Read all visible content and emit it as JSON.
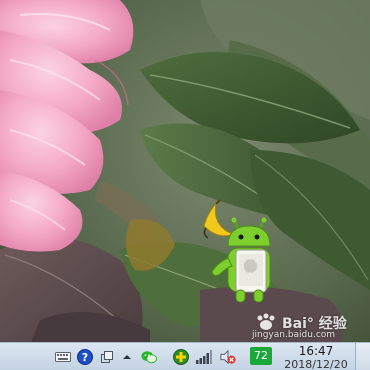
{
  "wallpaper": {
    "subject": "peony-and-leaves-photo"
  },
  "widget": {
    "name": "green-robot-pad-widget"
  },
  "watermark": {
    "brand": "Bai° 经验",
    "url": "jingyan.baidu.com"
  },
  "taskbar": {
    "tray_icons": [
      "keyboard-icon",
      "help-icon",
      "window-icon",
      "chevron-up-icon",
      "wechat-icon",
      "plus-icon",
      "signal-icon",
      "volume-muted-icon"
    ],
    "badge": "72",
    "time": "16:47",
    "date": "2018/12/20"
  },
  "colors": {
    "taskbar_top": "#dbe6f1",
    "taskbar_bottom": "#c4d3e3",
    "badge_green": "#1aa83a",
    "robot_green": "#7dcf2e",
    "petal_pink": "#f4a9c6"
  }
}
